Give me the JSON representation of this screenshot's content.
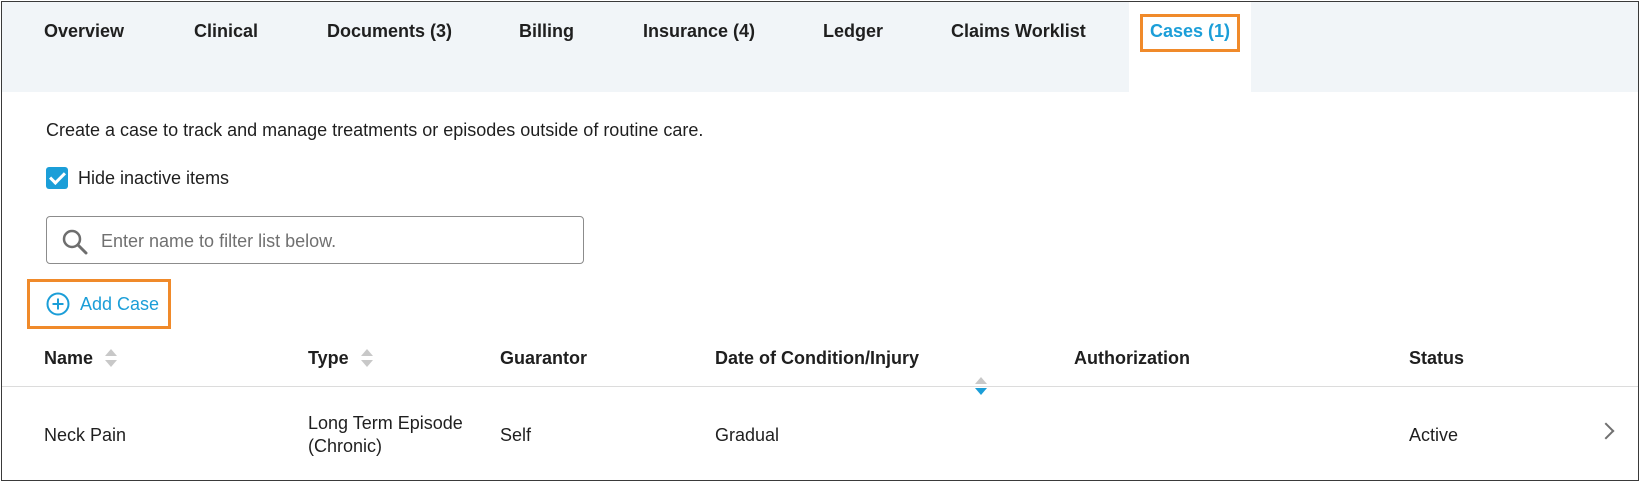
{
  "tabs": [
    {
      "label": "Overview"
    },
    {
      "label": "Clinical"
    },
    {
      "label": "Documents (3)"
    },
    {
      "label": "Billing"
    },
    {
      "label": "Insurance (4)"
    },
    {
      "label": "Ledger"
    },
    {
      "label": "Claims Worklist"
    },
    {
      "label": "Cases (1)",
      "active": true
    }
  ],
  "description": "Create a case to track and manage treatments or episodes outside of routine care.",
  "filter": {
    "hide_inactive_label": "Hide inactive items",
    "hide_inactive_checked": true,
    "search_placeholder": "Enter name to filter list below.",
    "search_value": ""
  },
  "add_case_label": "Add Case",
  "table": {
    "columns": [
      "Name",
      "Type",
      "Guarantor",
      "Date of Condition/Injury",
      "Authorization",
      "Status"
    ],
    "sort": {
      "column": "Date of Condition/Injury",
      "direction": "descending"
    },
    "rows": [
      {
        "name": "Neck Pain",
        "type_line1": "Long Term Episode",
        "type_line2": "(Chronic)",
        "guarantor": "Self",
        "date": "Gradual",
        "authorization": "",
        "status": "Active"
      }
    ]
  },
  "colors": {
    "accent": "#1b9ed8",
    "highlight": "#f08a2a",
    "tabbar_bg": "#f1f5f8"
  }
}
